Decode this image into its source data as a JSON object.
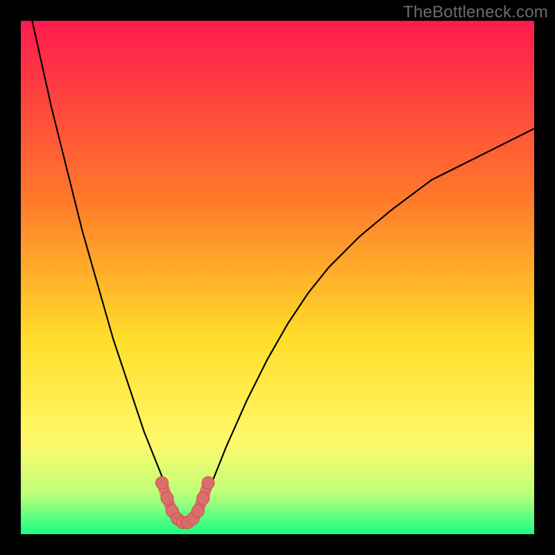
{
  "watermark": "TheBottleneck.com",
  "colors": {
    "gradient_top": "#ff1a4e",
    "gradient_mid1": "#ff7a2a",
    "gradient_mid2": "#ffde2a",
    "gradient_mid3": "#fff96a",
    "gradient_mid4": "#bfff7a",
    "gradient_bottom": "#18ff84",
    "curve": "#000000",
    "marker_fill": "#db6e6b",
    "marker_stroke": "#c94e4b"
  },
  "chart_data": {
    "type": "line",
    "title": "",
    "xlabel": "",
    "ylabel": "",
    "xlim": [
      0,
      100
    ],
    "ylim": [
      0,
      100
    ],
    "series": [
      {
        "name": "bottleneck-curve",
        "x": [
          0,
          2,
          4,
          6,
          8,
          10,
          12,
          14,
          16,
          18,
          20,
          22,
          24,
          26,
          28,
          30,
          31,
          32,
          33,
          34,
          36,
          38,
          40,
          44,
          48,
          52,
          56,
          60,
          66,
          72,
          80,
          88,
          96,
          100
        ],
        "y": [
          110,
          101,
          92,
          83,
          75,
          67,
          59,
          52,
          45,
          38,
          32,
          26,
          20,
          15,
          10,
          5,
          3,
          2,
          2,
          3,
          7,
          12,
          17,
          26,
          34,
          41,
          47,
          52,
          58,
          63,
          69,
          73,
          77,
          79
        ]
      }
    ],
    "markers": {
      "name": "highlight-band",
      "x": [
        27.5,
        28.5,
        29.5,
        30.5,
        31.5,
        32.5,
        33.5,
        34.5,
        35.5,
        36.5
      ],
      "y": [
        10,
        7,
        4.5,
        3,
        2.3,
        2.3,
        3,
        4.5,
        7,
        10
      ]
    }
  }
}
